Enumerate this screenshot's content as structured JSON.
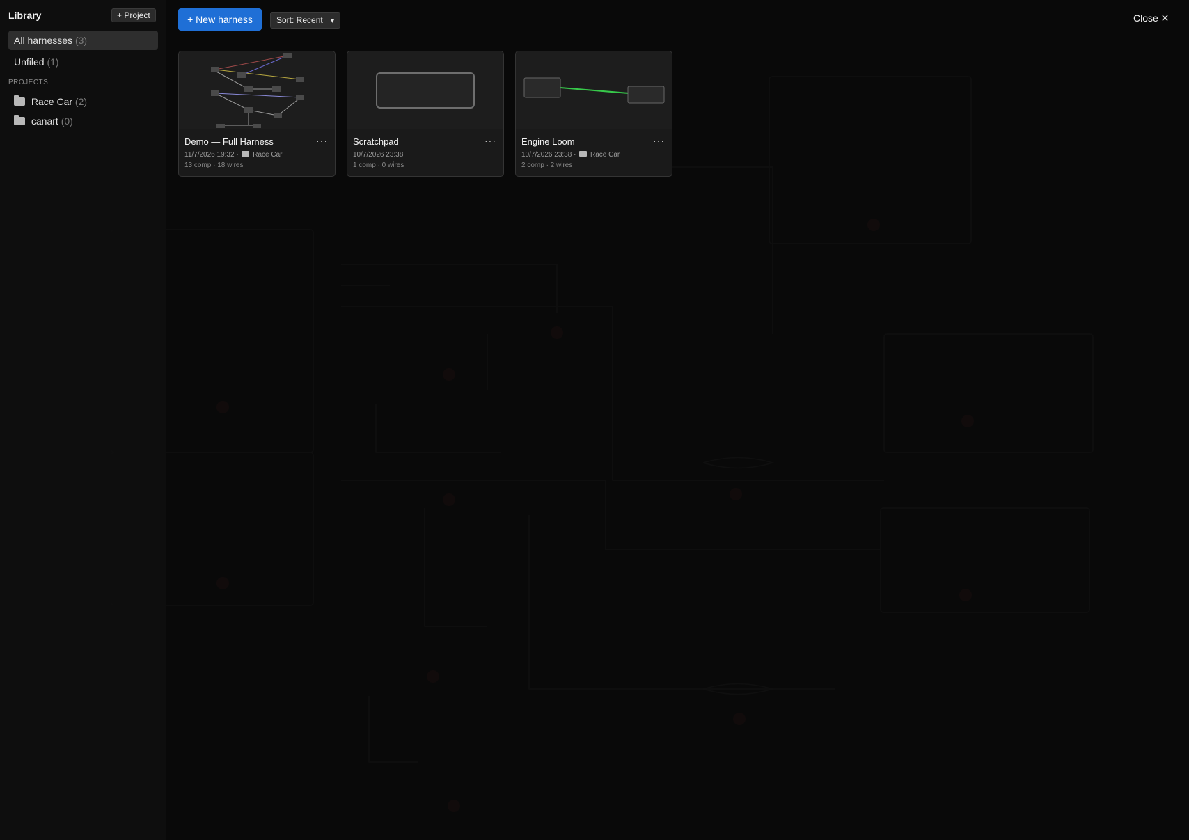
{
  "sidebar": {
    "title": "Library",
    "add_project_label": "+ Project",
    "all_label": "All harnesses",
    "all_count": "(3)",
    "unfiled_label": "Unfiled",
    "unfiled_count": "(1)",
    "projects_heading": "PROJECTS",
    "projects": [
      {
        "name": "Race Car",
        "count": "(2)"
      },
      {
        "name": "canart",
        "count": "(0)"
      }
    ]
  },
  "toolbar": {
    "new_harness_label": "+ New harness",
    "sort_label": "Sort: Recent",
    "close_label": "Close ✕"
  },
  "cards": [
    {
      "title": "Demo — Full Harness",
      "date": "11/7/2026 19:32",
      "project": "Race Car",
      "stats": "13 comp · 18 wires"
    },
    {
      "title": "Scratchpad",
      "date": "10/7/2026 23:38",
      "project": "",
      "stats": "1 comp · 0 wires"
    },
    {
      "title": "Engine Loom",
      "date": "10/7/2026 23:38",
      "project": "Race Car",
      "stats": "2 comp · 2 wires"
    }
  ],
  "menu_glyph": "···",
  "colors": {
    "accent": "#1f6fd6",
    "wire_green": "#37c84a",
    "background": "#0b0b0b"
  }
}
